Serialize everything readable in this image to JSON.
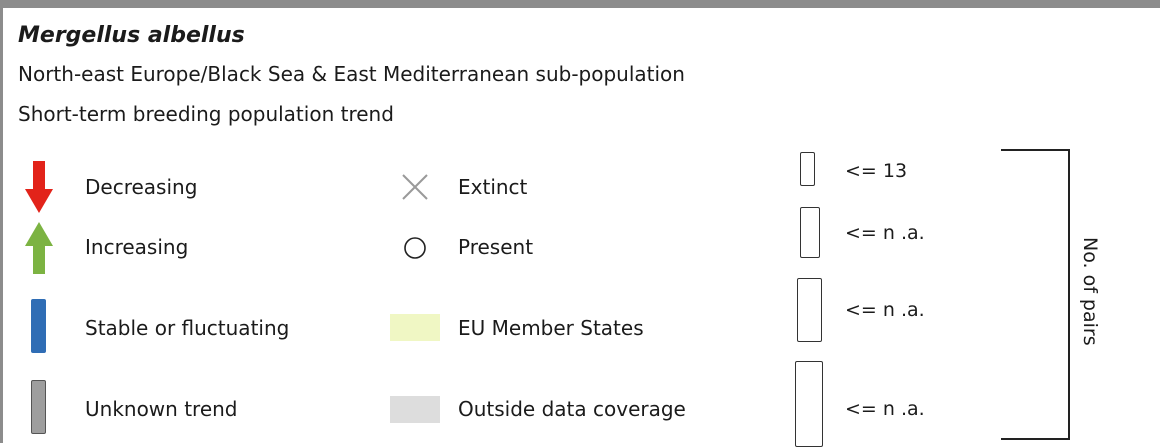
{
  "header": {
    "species": "Mergellus albellus",
    "population": "North-east Europe/Black Sea & East Mediterranean sub-population",
    "trend_title": "Short-term breeding population trend"
  },
  "trend_legend": [
    {
      "label": "Decreasing",
      "icon": "red-down-arrow-icon",
      "color": "#e2231a"
    },
    {
      "label": "Increasing",
      "icon": "green-up-arrow-icon",
      "color": "#7cb342"
    },
    {
      "label": "Stable or fluctuating",
      "icon": "blue-bar-icon",
      "color": "#2f6db5"
    },
    {
      "label": "Unknown trend",
      "icon": "grey-bar-icon",
      "color": "#9e9e9e"
    }
  ],
  "status_legend": [
    {
      "label": "Extinct",
      "icon": "cross-icon"
    },
    {
      "label": "Present",
      "icon": "circle-icon"
    },
    {
      "label": "EU Member States",
      "icon": "yellow-swatch-icon",
      "color": "#f0f7c4"
    },
    {
      "label": "Outside data coverage",
      "icon": "grey-swatch-icon",
      "color": "#dddddd"
    }
  ],
  "size_legend": {
    "axis_label": "No. of pairs",
    "items": [
      {
        "label": "<= 13"
      },
      {
        "label": "<= n .a."
      },
      {
        "label": "<= n .a."
      },
      {
        "label": "<= n .a."
      }
    ]
  }
}
